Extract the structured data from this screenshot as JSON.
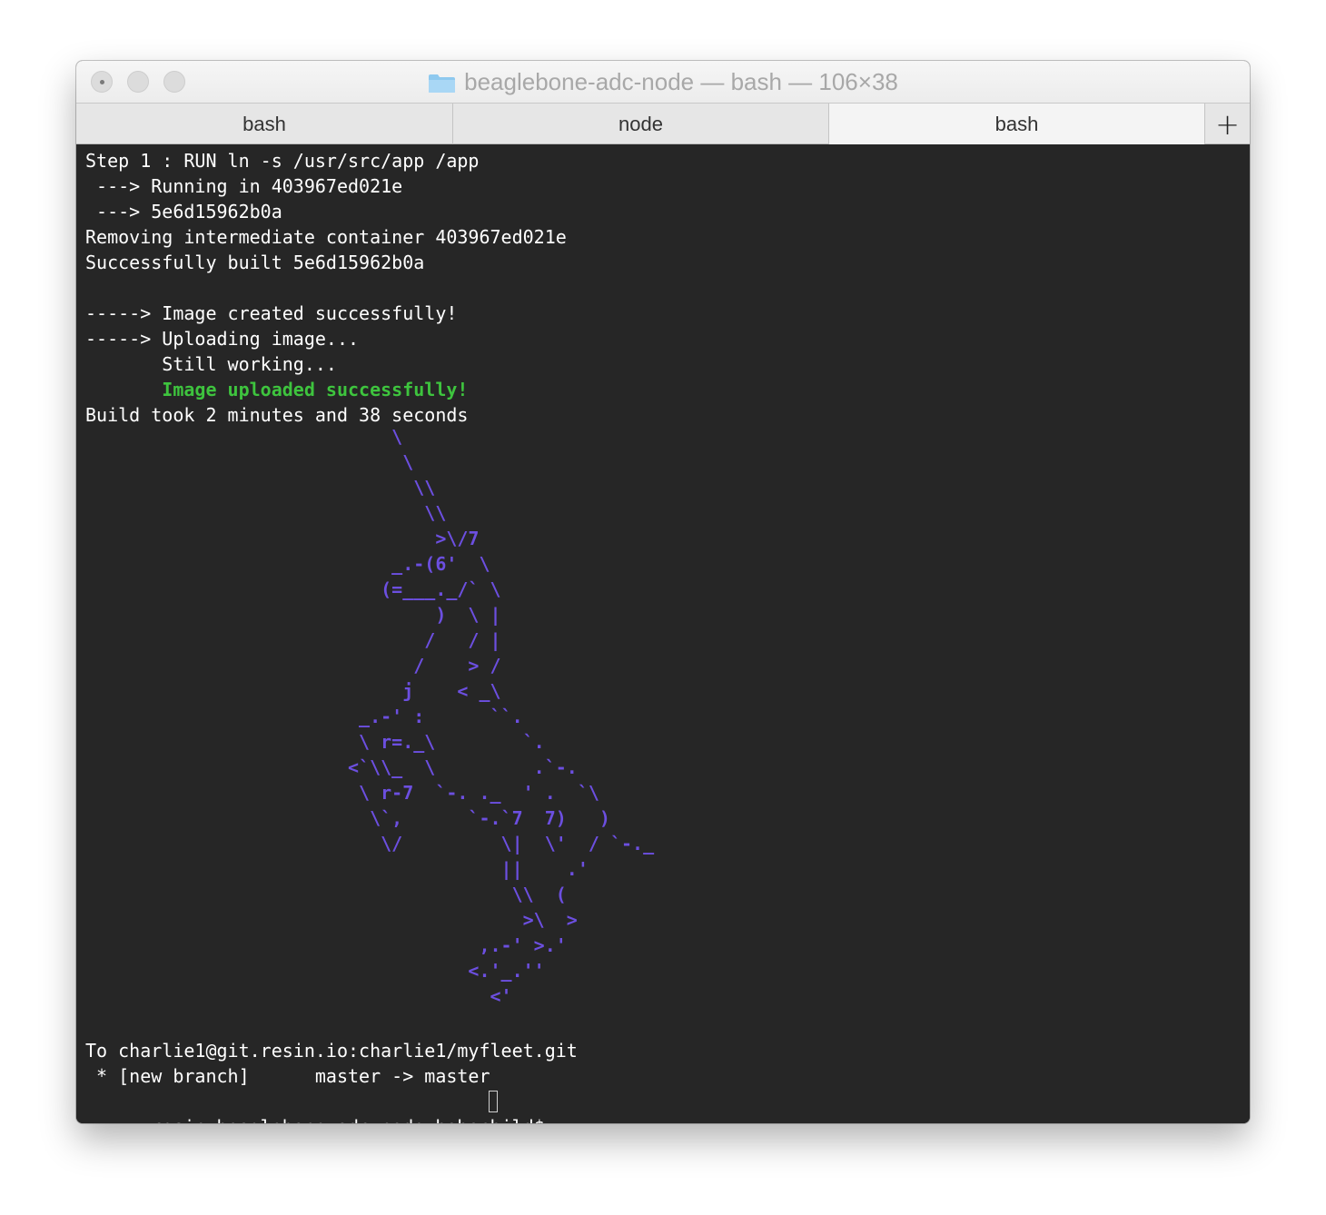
{
  "window": {
    "title": "beaglebone-adc-node — bash — 106×38",
    "folder_icon": "folder-icon",
    "traffic_lights": [
      "close-button",
      "minimize-button",
      "zoom-button"
    ]
  },
  "tabs": [
    {
      "label": "bash",
      "active": false
    },
    {
      "label": "node",
      "active": false
    },
    {
      "label": "bash",
      "active": true
    }
  ],
  "new_tab_label": "+",
  "terminal": {
    "colors": {
      "background": "#262626",
      "text": "#ffffff",
      "success": "#3ec43e",
      "unicorn": "#6c4fe0"
    },
    "build_lines": [
      "Step 1 : RUN ln -s /usr/src/app /app",
      " ---> Running in 403967ed021e",
      " ---> 5e6d15962b0a",
      "Removing intermediate container 403967ed021e",
      "Successfully built 5e6d15962b0a",
      "",
      "-----> Image created successfully!",
      "-----> Uploading image...",
      "       Still working..."
    ],
    "upload_success": "       Image uploaded successfully!",
    "build_time": "Build took 2 minutes and 38 seconds",
    "unicorn_ascii": "                            \\\n                             \\\n                              \\\\\n                               \\\\\n                                >\\/7\n                            _.-(6'  \\\n                           (=___._/` \\\n                                )  \\ |\n                               /   / |\n                              /    > /\n                             j    < _\\\n                         _.-' :      ``.\n                         \\ r=._\\        `.\n                        <`\\\\_  \\         .`-.\n                         \\ r-7  `-. ._  ' .  `\\\n                          \\`,      `-.`7  7)   )\n                           \\/         \\|  \\'  / `-._\n                                      ||    .'\n                                       \\\\  (\n                                        >\\  >\n                                    ,.-' >.'\n                                   <.'_.''\n                                     <'",
    "push_lines": [
      "To charlie1@git.resin.io:charlie1/myfleet.git",
      " * [new branch]      master -> master"
    ],
    "prompt": "resin:beaglebone-adc-node hobochild$ "
  }
}
